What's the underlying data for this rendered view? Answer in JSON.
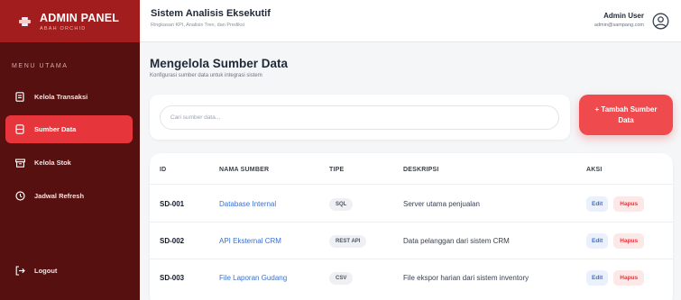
{
  "brand": {
    "title": "ADMIN PANEL",
    "subtitle": "ABAH ORCHID",
    "icon": "logo-icon"
  },
  "sidebar": {
    "menu_header": "MENU UTAMA",
    "items": [
      {
        "label": "Kelola Transaksi",
        "icon": "transaction-icon"
      },
      {
        "label": "Sumber Data",
        "icon": "database-icon",
        "active": true
      },
      {
        "label": "Kelola Stok",
        "icon": "inventory-icon"
      },
      {
        "label": "Jadwal Refresh",
        "icon": "clock-icon"
      }
    ],
    "logout_label": "Logout"
  },
  "header": {
    "title": "Sistem Analisis Eksekutif",
    "subtitle": "Ringkasan KPI, Analisis Tren, dan Prediksi",
    "user_name": "Admin User",
    "user_email": "admin@sampang.com"
  },
  "page": {
    "title": "Mengelola Sumber Data",
    "subtitle": "Konfigurasi sumber data untuk integrasi sistem"
  },
  "search": {
    "placeholder": "Cari sumber data...",
    "value": ""
  },
  "add_button": {
    "line1": "+ Tambah Sumber",
    "line2": "Data"
  },
  "table": {
    "headers": {
      "id": "ID",
      "name": "NAMA SUMBER",
      "type": "TIPE",
      "desc": "DESKRIPSI",
      "actions": "AKSI"
    },
    "rows": [
      {
        "id": "SD-001",
        "name": "Database Internal",
        "type": "SQL",
        "desc": "Server utama penjualan"
      },
      {
        "id": "SD-002",
        "name": "API Eksternal CRM",
        "type": "REST API",
        "desc": "Data pelanggan dari sistem CRM"
      },
      {
        "id": "SD-003",
        "name": "File Laporan Gudang",
        "type": "CSV",
        "desc": "File ekspor harian dari sistem inventory"
      }
    ],
    "edit_label": "Edit",
    "delete_label": "Hapus"
  },
  "colors": {
    "sidebar_bg": "#561010",
    "brand_bg": "#a21e1e",
    "accent": "#ef4a4d",
    "link": "#3b6fd1"
  }
}
